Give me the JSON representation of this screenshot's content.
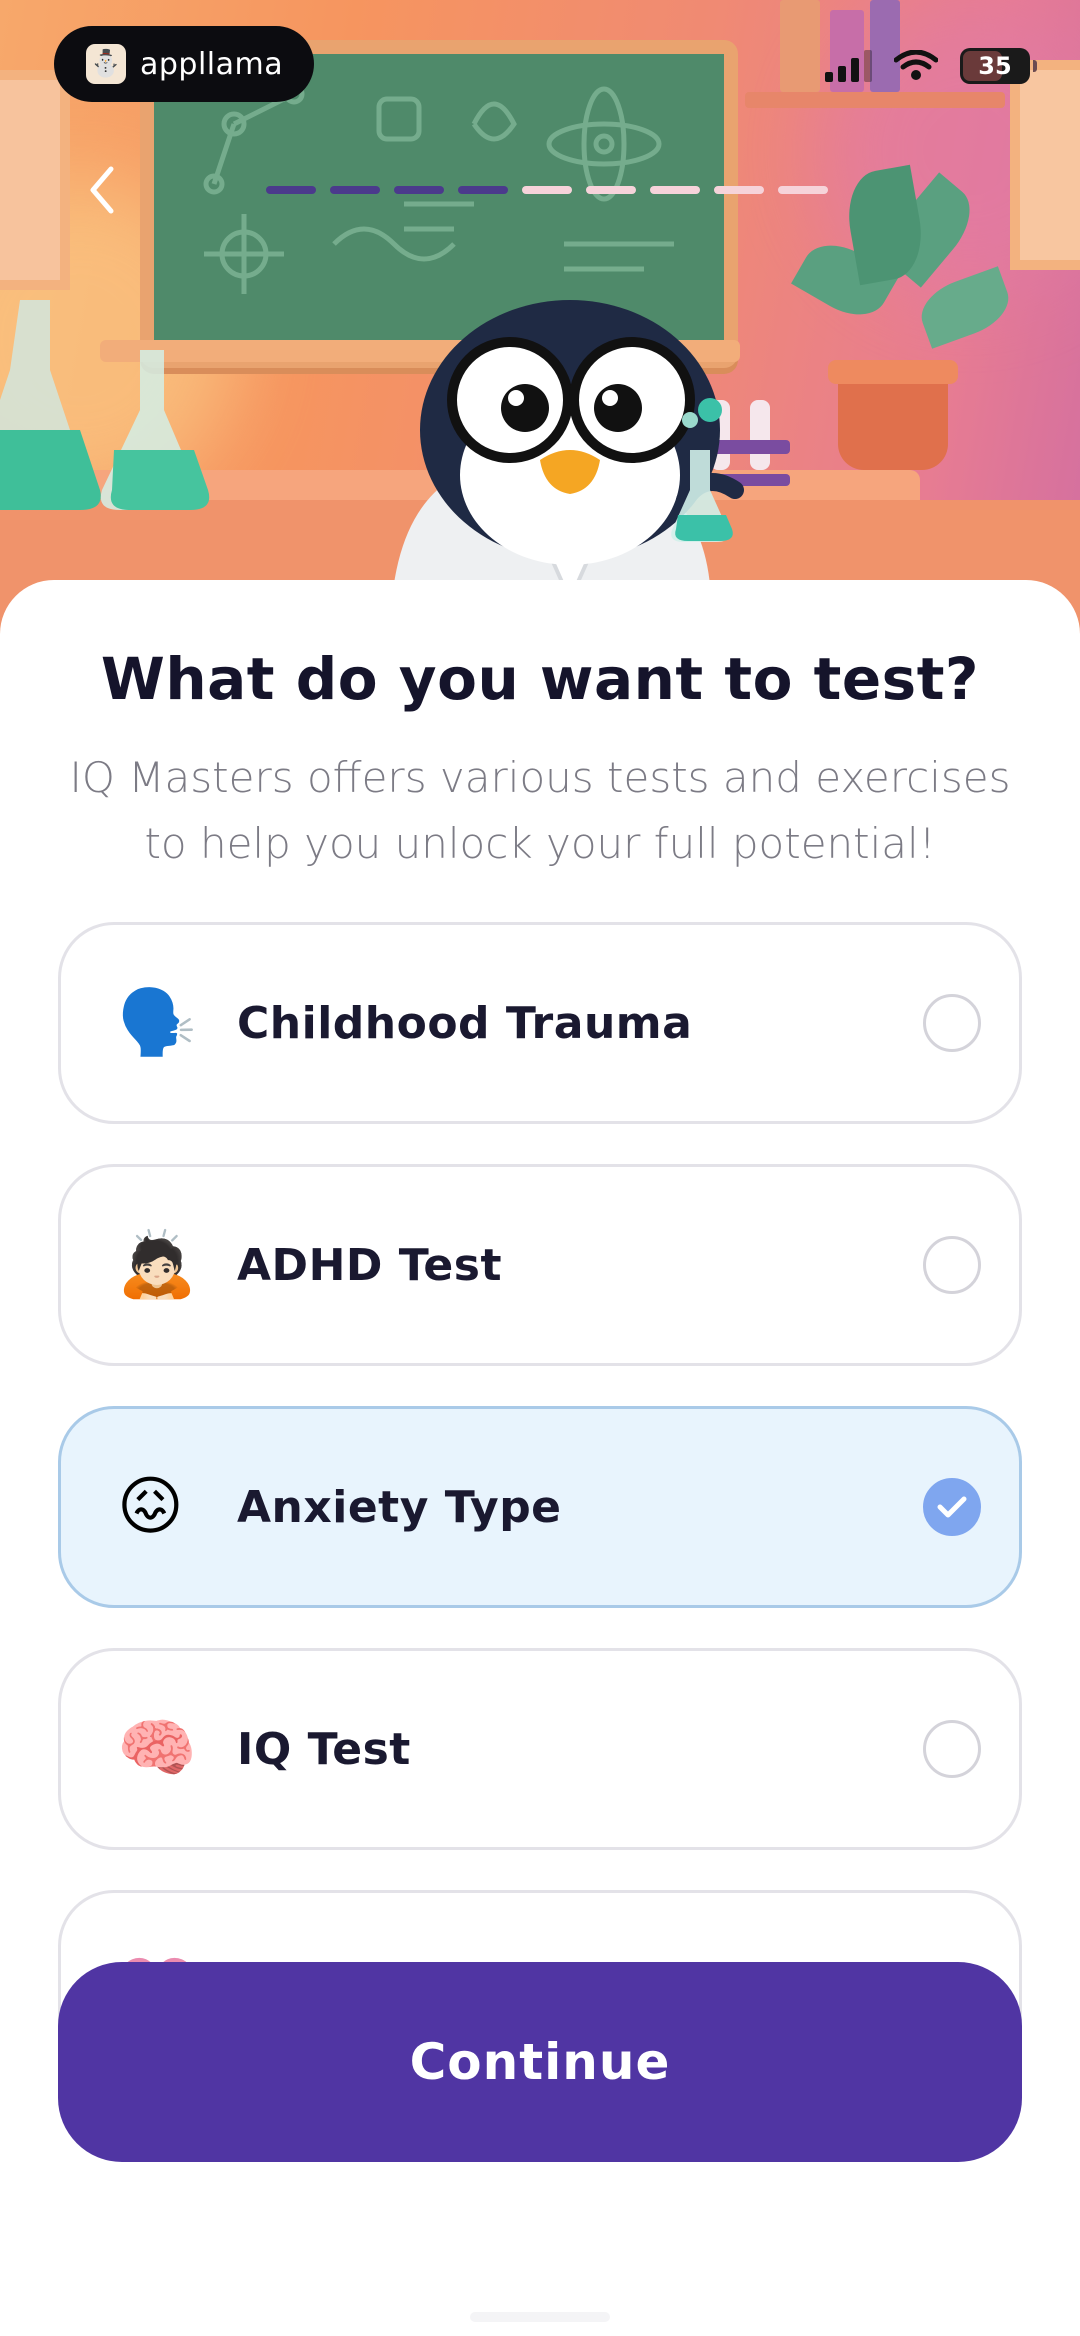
{
  "status_bar": {
    "brand_name": "appllama",
    "battery_level": "35"
  },
  "nav": {
    "progress_total": 9,
    "progress_done": 4,
    "progress_done_color": "#4b3a8c",
    "progress_todo_color": "#f6d3da"
  },
  "header": {
    "title": "What do you want to test?",
    "subtitle": "IQ Masters offers various tests and exercises to help you unlock your full potential!"
  },
  "options": [
    {
      "label": "Childhood Trauma",
      "icon": "speaking-head-icon",
      "glyph": "🗣️",
      "selected": false
    },
    {
      "label": "ADHD Test",
      "icon": "person-bowing-icon",
      "glyph": "🙇🏻",
      "selected": false
    },
    {
      "label": "Anxiety Type",
      "icon": "confounded-face-icon",
      "glyph": "😖",
      "selected": true
    },
    {
      "label": "IQ Test",
      "icon": "brain-icon",
      "glyph": "🧠",
      "selected": false
    },
    {
      "label": "",
      "icon": "heart-icon",
      "glyph": "💗",
      "selected": false
    }
  ],
  "continue_label": "Continue",
  "colors": {
    "accent": "#5035a3",
    "selected_bg": "#e8f4fd",
    "check": "#7fa6ef"
  }
}
